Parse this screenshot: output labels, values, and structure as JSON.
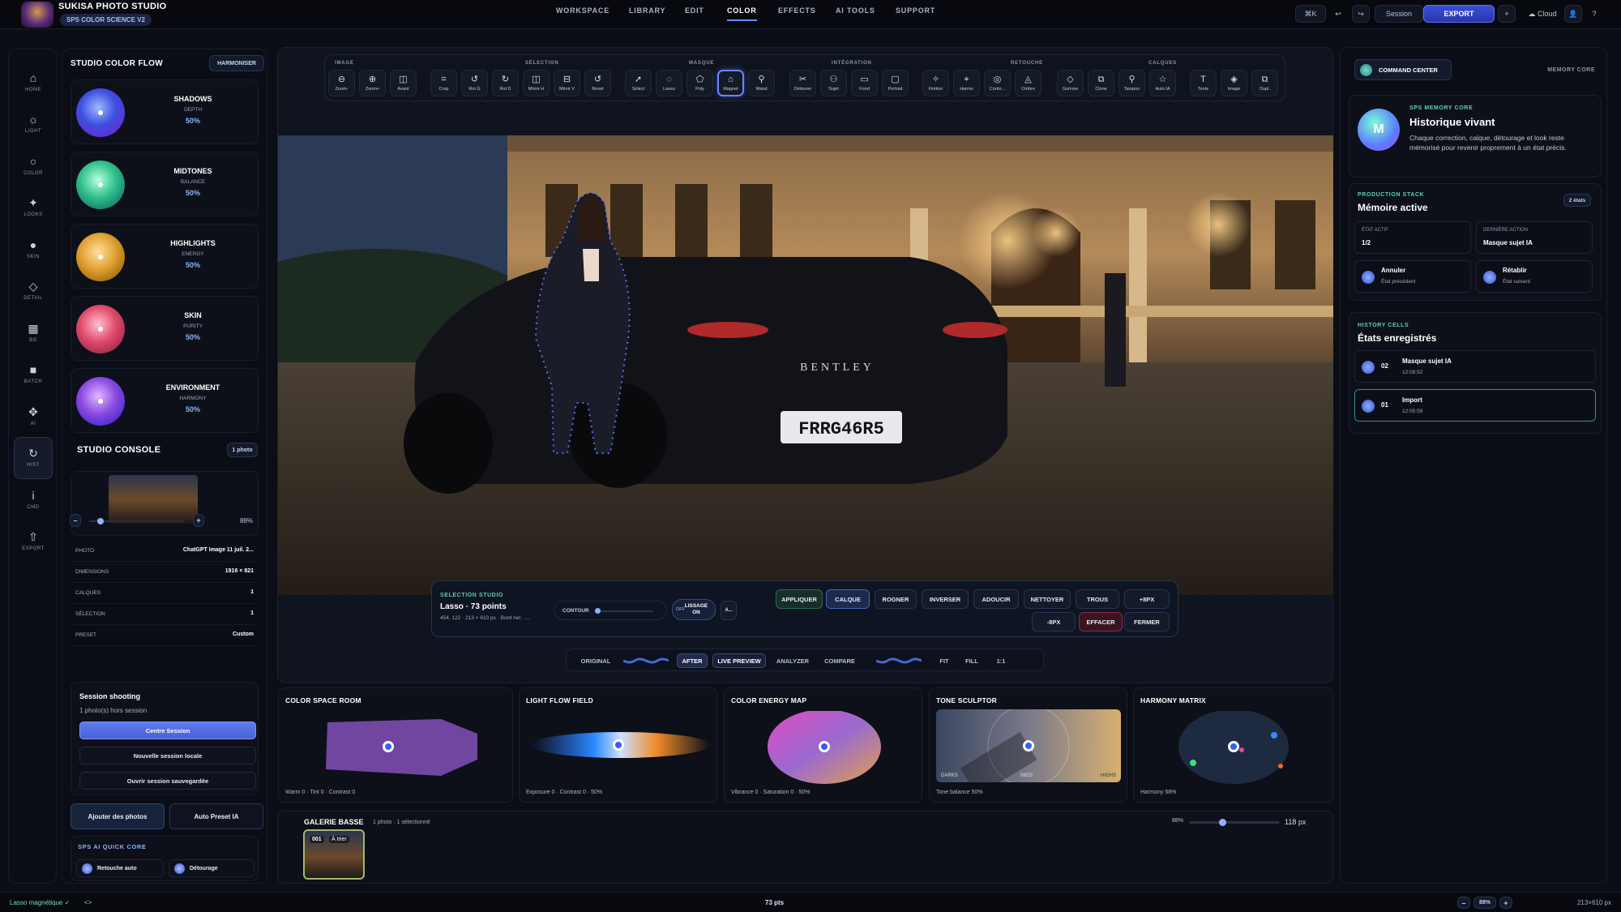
{
  "app": {
    "title": "SUKISA PHOTO STUDIO",
    "badge": "SPS COLOR SCIENCE V2"
  },
  "nav": [
    "WORKSPACE",
    "LIBRARY",
    "EDIT",
    "COLOR",
    "EFFECTS",
    "AI TOOLS",
    "SUPPORT"
  ],
  "nav_active": "COLOR",
  "topbar": {
    "cmd": "⌘K",
    "undo": "↩",
    "redo": "↪",
    "session": "Session",
    "export": "EXPORT",
    "plus": "+",
    "cloud": "☁ Cloud",
    "user": "👤",
    "help": "?"
  },
  "rail": [
    {
      "label": "HOME",
      "icon": "⌂"
    },
    {
      "label": "LIGHT",
      "icon": "☼"
    },
    {
      "label": "COLOR",
      "icon": "○"
    },
    {
      "label": "LOOKS",
      "icon": "✦"
    },
    {
      "label": "SKIN",
      "icon": "●"
    },
    {
      "label": "DETAIL",
      "icon": "◇"
    },
    {
      "label": "BG",
      "icon": "▦"
    },
    {
      "label": "BATCH",
      "icon": "■"
    },
    {
      "label": "AI",
      "icon": "✥"
    },
    {
      "label": "HIST",
      "icon": "↻"
    },
    {
      "label": "CMD",
      "icon": "i"
    },
    {
      "label": "EXPORT",
      "icon": "⇧"
    }
  ],
  "color_flow": {
    "title": "STUDIO COLOR FLOW",
    "harmoniser": "HARMONISER",
    "items": [
      {
        "name": "SHADOWS",
        "sub": "DEPTH",
        "value": "50%"
      },
      {
        "name": "MIDTONES",
        "sub": "BALANCE",
        "value": "50%"
      },
      {
        "name": "HIGHLIGHTS",
        "sub": "ENERGY",
        "value": "50%"
      },
      {
        "name": "SKIN",
        "sub": "PURITY",
        "value": "50%"
      },
      {
        "name": "ENVIRONMENT",
        "sub": "HARMONY",
        "value": "50%"
      }
    ]
  },
  "console": {
    "title": "STUDIO CONSOLE",
    "badge": "1 photo",
    "zoom_minus": "–",
    "zoom_plus": "+",
    "zoom_value": "88%",
    "zoom_level": 0.12,
    "rows": [
      {
        "k": "PHOTO",
        "v": "ChatGPT Image 11 juil. 2..."
      },
      {
        "k": "DIMENSIONS",
        "v": "1916 × 821"
      },
      {
        "k": "CALQUES",
        "v": "1"
      },
      {
        "k": "SÉLECTION",
        "v": "1"
      },
      {
        "k": "PRESET",
        "v": "Custom"
      }
    ]
  },
  "session": {
    "title": "Session shooting",
    "sub": "1 photo(s) hors session",
    "btn1": "Centre Session",
    "btn2": "Nouvelle session locale",
    "btn3": "Ouvrir session sauvegardée"
  },
  "actions": {
    "add": "Ajouter des photos",
    "auto": "Auto Preset IA"
  },
  "quick_core": {
    "title": "SPS AI QUICK CORE",
    "a": "Retouche auto",
    "b": "Détourage"
  },
  "toolbar": {
    "groups": [
      "IMAGE",
      "SÉLECTION",
      "MASQUE",
      "INTÉGRATION",
      "RETOUCHE",
      "CALQUES"
    ],
    "tools": [
      {
        "label": "Zoom-",
        "icon": "⊖"
      },
      {
        "label": "Zoom+",
        "icon": "⊕"
      },
      {
        "label": "Avant",
        "icon": "◫"
      },
      {
        "label": "Crop",
        "icon": "⌗"
      },
      {
        "label": "Rot G",
        "icon": "↺"
      },
      {
        "label": "Rot D",
        "icon": "↻"
      },
      {
        "label": "Miroir H",
        "icon": "◫"
      },
      {
        "label": "Miroir V",
        "icon": "⊟"
      },
      {
        "label": "Reset",
        "icon": "↺"
      },
      {
        "label": "Sélect",
        "icon": "➚"
      },
      {
        "label": "Lasso",
        "icon": "◌"
      },
      {
        "label": "Poly",
        "icon": "⬠"
      },
      {
        "label": "Magnet",
        "icon": "⌂"
      },
      {
        "label": "Wand",
        "icon": "⚲"
      },
      {
        "label": "Détourer",
        "icon": "✂"
      },
      {
        "label": "Sujet",
        "icon": "⚇"
      },
      {
        "label": "Fond",
        "icon": "▭"
      },
      {
        "label": "Portrait",
        "icon": "▢"
      },
      {
        "label": "Finition",
        "icon": "✧"
      },
      {
        "label": "Harmo",
        "icon": "⌖"
      },
      {
        "label": "Conto...",
        "icon": "◎"
      },
      {
        "label": "Ombre",
        "icon": "◬"
      },
      {
        "label": "Gomme",
        "icon": "◇"
      },
      {
        "label": "Clone",
        "icon": "⧉"
      },
      {
        "label": "Tampon",
        "icon": "⚲"
      },
      {
        "label": "Auto IA",
        "icon": "☆"
      },
      {
        "label": "Texte",
        "icon": "T"
      },
      {
        "label": "Image",
        "icon": "◈"
      },
      {
        "label": "Dupl.",
        "icon": "⧉"
      }
    ]
  },
  "photo": {
    "plate": "FRRG46R5",
    "brand": "BENTLEY"
  },
  "selection": {
    "eyebrow": "SELECTION STUDIO",
    "title": "Lasso · 73 points",
    "meta": "454, 122 · 213 × 610 px · Bord net · ...",
    "contour": "CONTOUR",
    "lissage": "LISSAGE ON",
    "off": "OFF",
    "a": "A...",
    "buttons_row1": [
      "APPLIQUER",
      "CALQUE",
      "ROGNER",
      "INVERSER",
      "ADOUCIR",
      "NETTOYER",
      "TROUS",
      "+8PX"
    ],
    "buttons_row2": [
      "-8PX",
      "EFFACER",
      "FERMER"
    ]
  },
  "viewbar": {
    "original": "ORIGINAL",
    "after": "AFTER",
    "live": "LIVE PREVIEW",
    "analyzer": "ANALYZER",
    "compare": "COMPARE",
    "fit": "FIT",
    "fill": "FILL",
    "one": "1:1"
  },
  "analysis": [
    {
      "title": "COLOR SPACE ROOM",
      "foot": "Warm 0 · Tint 0 · Contrast 0"
    },
    {
      "title": "LIGHT FLOW FIELD",
      "foot": "Exposure 0 · Contrast 0 · 50%"
    },
    {
      "title": "COLOR ENERGY MAP",
      "foot": "Vibrance 0 · Saturation 0 · 50%"
    },
    {
      "title": "TONE SCULPTOR",
      "foot": "Tone balance 50%",
      "darks": "DARKS",
      "mids": "MIDS",
      "highs": "HIGHS"
    },
    {
      "title": "HARMONY MATRIX",
      "foot": "Harmony 58%"
    }
  ],
  "gallery": {
    "title": "GALERIE BASSE",
    "sub": "1 photo · 1 sélectionné",
    "zoom": "88%",
    "size": "118 px",
    "thumb_num": "001",
    "thumb_tag": "À trier"
  },
  "right": {
    "command": "COMMAND CENTER",
    "memory_core": "MEMORY CORE",
    "mem_eyebrow": "SPS MEMORY CORE",
    "mem_title": "Historique vivant",
    "mem_desc": "Chaque correction, calque, détourage et look reste mémorisé pour revenir proprement à un état précis.",
    "avatar": "M",
    "stack_eyebrow": "PRODUCTION STACK",
    "stack_title": "Mémoire active",
    "stack_badge": "2 états",
    "etat_k": "ÉTAT ACTIF",
    "etat_v": "1/2",
    "last_k": "DERNIÈRE ACTION",
    "last_v": "Masque sujet IA",
    "undo_t": "Annuler",
    "undo_s": "État précédent",
    "redo_t": "Rétablir",
    "redo_s": "État suivant",
    "cells_eyebrow": "HISTORY CELLS",
    "cells_title": "États enregistrés",
    "cells": [
      {
        "num": "02",
        "name": "Masque sujet IA",
        "time": "12:08:52"
      },
      {
        "num": "01",
        "name": "Import",
        "time": "12:05:59"
      }
    ]
  },
  "footer": {
    "left": "Lasso magnétique ✓",
    "arrows": "<>",
    "center": "73 pts",
    "minus": "–",
    "zoom": "88%",
    "plus": "+",
    "right": "213×610 px"
  }
}
